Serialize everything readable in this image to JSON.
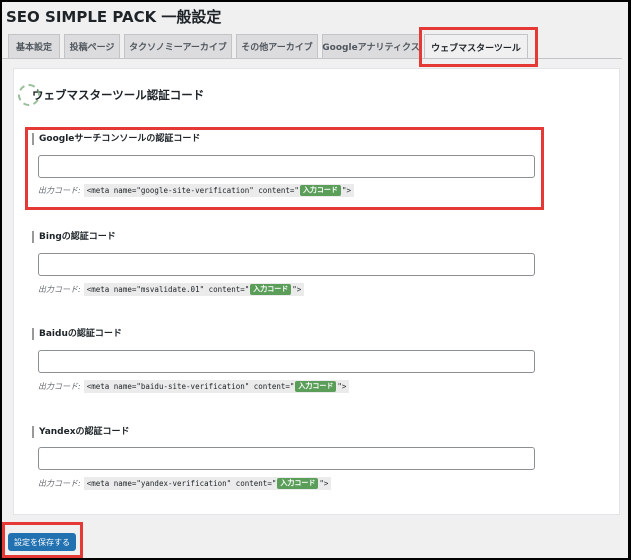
{
  "page_title": "SEO SIMPLE PACK 一般設定",
  "tabs": [
    {
      "label": "基本設定"
    },
    {
      "label": "投稿ページ"
    },
    {
      "label": "タクソノミーアーカイブ"
    },
    {
      "label": "その他アーカイブ"
    },
    {
      "label": "Googleアナリティクス"
    },
    {
      "label": "ウェブマスターツール"
    }
  ],
  "active_tab_index": 5,
  "section_title": "ウェブマスターツール認証コード",
  "output_label": "出力コード:",
  "input_badge": "入力コード",
  "fields": [
    {
      "label": "Googleサーチコンソールの認証コード",
      "value": "",
      "code_prefix": "<meta name=\"google-site-verification\" content=\"",
      "code_suffix": "\">"
    },
    {
      "label": "Bingの認証コード",
      "value": "",
      "code_prefix": "<meta name=\"msvalidate.01\" content=\"",
      "code_suffix": "\">"
    },
    {
      "label": "Baiduの認証コード",
      "value": "",
      "code_prefix": "<meta name=\"baidu-site-verification\" content=\"",
      "code_suffix": "\">"
    },
    {
      "label": "Yandexの認証コード",
      "value": "",
      "code_prefix": "<meta name=\"yandex-verification\" content=\"",
      "code_suffix": "\">"
    }
  ],
  "save_button": "設定を保存する",
  "colors": {
    "highlight": "#e53935",
    "primary": "#2271b1",
    "badge": "#5a9e5a"
  }
}
